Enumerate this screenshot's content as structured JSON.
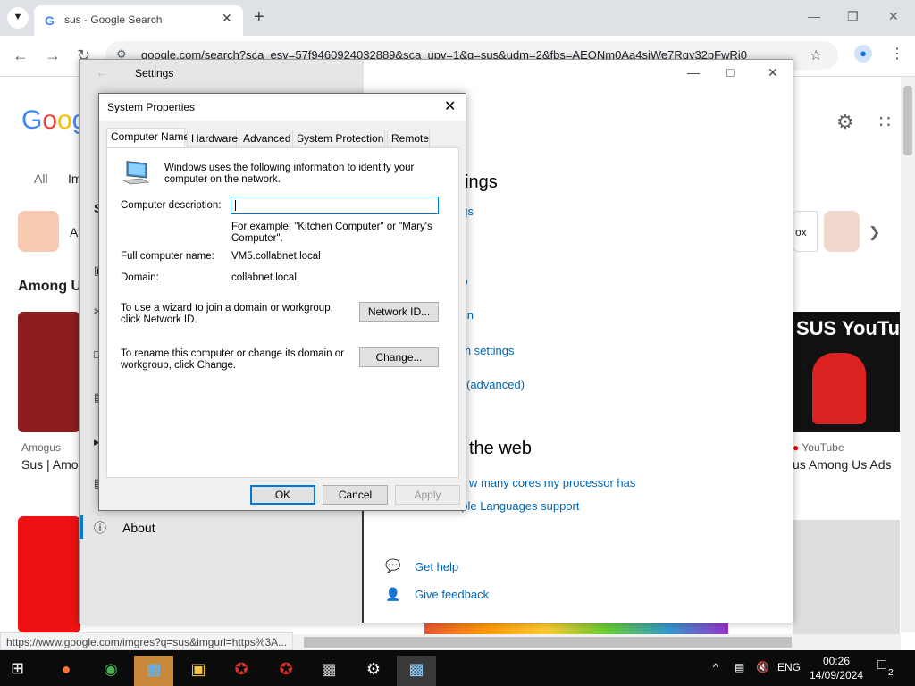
{
  "browser": {
    "tab_title": "sus - Google Search",
    "url": "google.com/search?sca_esv=57f9460924032889&sca_upv=1&q=sus&udm=2&fbs=AEQNm0Aa4sjWe7Rqy32pFwRj0",
    "status_url": "https://www.google.com/imgres?q=sus&imgurl=https%3A..."
  },
  "google": {
    "logo": "Goog",
    "tab_all": "All",
    "tab_images": "Im",
    "chip_label": "A",
    "section_heading": "Among Us",
    "left_source": "Amogus",
    "left_caption": "Sus | Amo",
    "right_source": "YouTube",
    "right_caption": "us Among Us Ads",
    "right_chip_text": "ox",
    "thumb_title": "SUS YouTub"
  },
  "settings": {
    "title": "Settings",
    "heading": "ttings",
    "links": [
      "ngs",
      "er",
      "op",
      "tion",
      "em settings",
      "C (advanced)"
    ],
    "web_heading": "the web",
    "web_links": [
      "w many cores my processor has",
      "uple Languages support"
    ],
    "about_label": "About",
    "left_partial": "S",
    "help_label": "Get help",
    "feedback_label": "Give feedback"
  },
  "dialog": {
    "title": "System Properties",
    "tabs": [
      "Computer Name",
      "Hardware",
      "Advanced",
      "System Protection",
      "Remote"
    ],
    "intro": "Windows uses the following information to identify your computer on the network.",
    "desc_label": "Computer description:",
    "desc_value": "",
    "example": "For example: \"Kitchen Computer\" or \"Mary's Computer\".",
    "full_name_label": "Full computer name:",
    "full_name_value": "VM5.collabnet.local",
    "domain_label": "Domain:",
    "domain_value": "collabnet.local",
    "wizard_text": "To use a wizard to join a domain or workgroup, click Network ID.",
    "network_id_button": "Network ID...",
    "rename_text": "To rename this computer or change its domain or workgroup, click Change.",
    "change_button": "Change...",
    "ok_button": "OK",
    "cancel_button": "Cancel",
    "apply_button": "Apply"
  },
  "taskbar": {
    "language": "ENG",
    "time": "00:26",
    "date": "14/09/2024",
    "notifications": "2"
  }
}
